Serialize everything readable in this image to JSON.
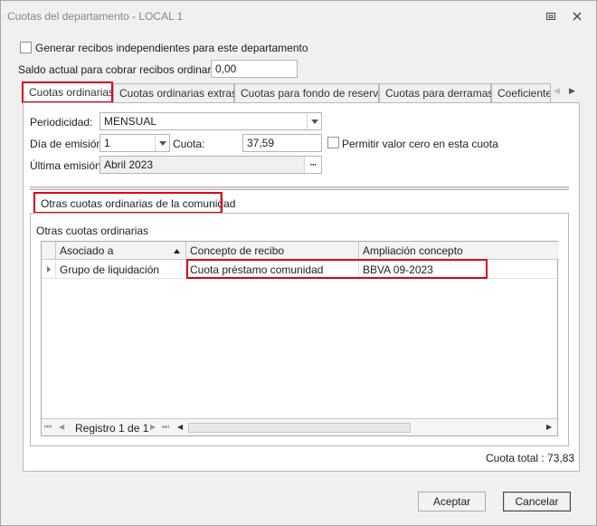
{
  "window": {
    "title": "Cuotas del departamento - LOCAL 1",
    "restore_glyph": "⧉",
    "close_glyph": "✕"
  },
  "top": {
    "independent_receipts_label": "Generar recibos independientes para este departamento",
    "balance_label": "Saldo actual para cobrar recibos ordinarios:",
    "balance_value": "0,00"
  },
  "tabs": [
    {
      "label": "Cuotas ordinarias",
      "active": true
    },
    {
      "label": "Cuotas ordinarias extras",
      "active": false
    },
    {
      "label": "Cuotas para fondo de reserva",
      "active": false
    },
    {
      "label": "Cuotas para derramas",
      "active": false
    },
    {
      "label": "Coeficientes",
      "active": false
    }
  ],
  "tab_scroll": {
    "left_glyph": "◀",
    "right_glyph": "▶"
  },
  "form": {
    "periodicity_label": "Periodicidad:",
    "periodicity_value": "MENSUAL",
    "issue_day_label": "Día de emisión:",
    "issue_day_value": "1",
    "fee_label": "Cuota:",
    "fee_value": "37,59",
    "allow_zero_label": "Permitir valor cero en esta cuota",
    "last_issue_label": "Última emisión:",
    "last_issue_value": "Abril 2023",
    "ellipsis_glyph": "···"
  },
  "other_fees": {
    "tab_label": "Otras cuotas ordinarias de la comunidad",
    "group_label": "Otras cuotas ordinarias",
    "columns": [
      "Asociado a",
      "Concepto de recibo",
      "Ampliación concepto"
    ],
    "rows": [
      {
        "asociado": "Grupo de liquidación",
        "concepto": "Cuota préstamo comunidad",
        "ampliacion": "BBVA 09-2023"
      }
    ],
    "navigator": {
      "record_text": "Registro 1 de 1",
      "first_glyph": "⏮",
      "prev_glyph": "◀",
      "next_glyph": "▶",
      "last_glyph": "⏭"
    }
  },
  "total_label": "Cuota total : 73,83",
  "buttons": {
    "accept": "Aceptar",
    "cancel": "Cancelar"
  }
}
